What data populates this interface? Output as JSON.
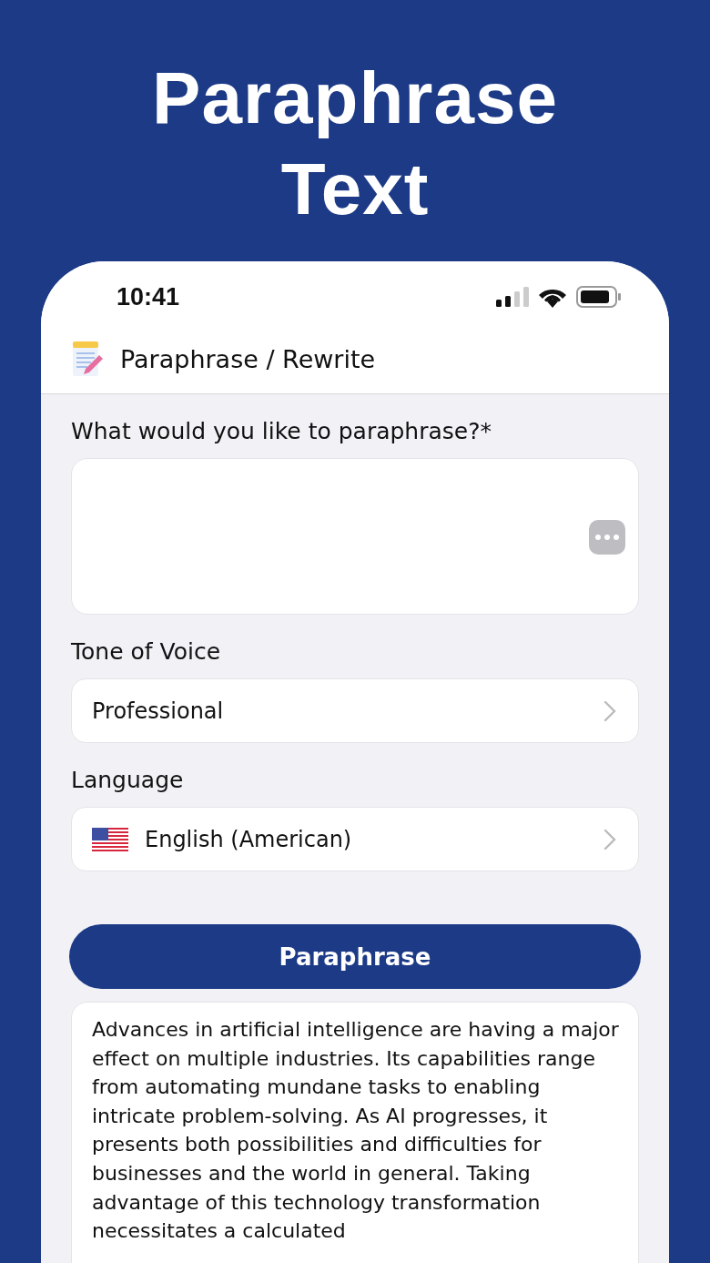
{
  "headline": "Paraphrase Text",
  "status_bar": {
    "time": "10:41"
  },
  "header": {
    "title": "Paraphrase / Rewrite"
  },
  "form": {
    "input_label": "What would you like to paraphrase?*",
    "tone_label": "Tone of Voice",
    "tone_value": "Professional",
    "language_label": "Language",
    "language_value": "English (American)"
  },
  "button": "Paraphrase",
  "result": "Advances in artificial intelligence are having a major effect on multiple industries. Its capabilities range from automating mundane tasks to enabling intricate problem-solving. As AI progresses, it presents both possibilities and difficulties for businesses and the world in general. Taking advantage of this technology transformation necessitates a calculated"
}
